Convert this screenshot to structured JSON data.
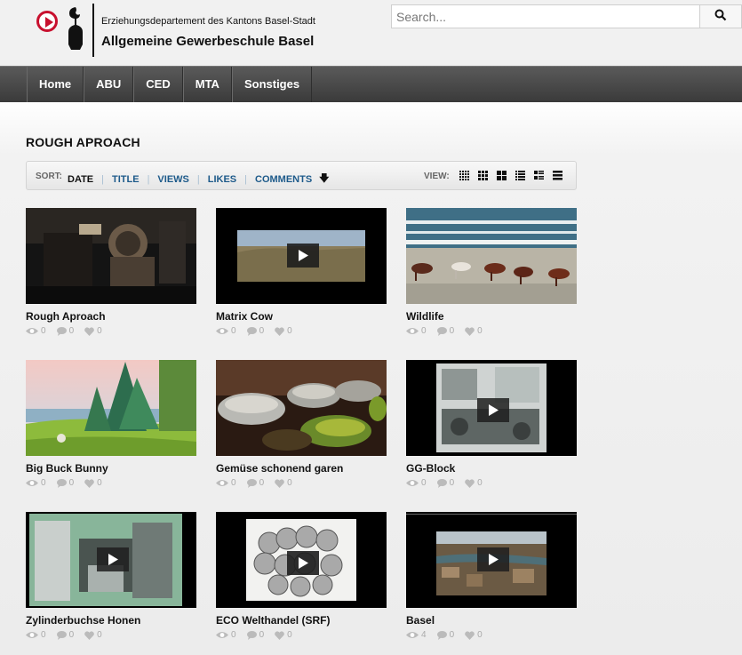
{
  "header": {
    "department": "Erziehungsdepartement des Kantons Basel-Stadt",
    "school": "Allgemeine Gewerbeschule Basel",
    "search_placeholder": "Search..."
  },
  "nav": [
    "Home",
    "ABU",
    "CED",
    "MTA",
    "Sonstiges"
  ],
  "page_title": "ROUGH APROACH",
  "sortbar": {
    "sort_label": "SORT:",
    "options": [
      "DATE",
      "TITLE",
      "VIEWS",
      "LIKES",
      "COMMENTS"
    ],
    "active": "DATE",
    "view_label": "VIEW:"
  },
  "videos": [
    {
      "title": "Rough Aproach",
      "views": "0",
      "comments": "0",
      "likes": "0"
    },
    {
      "title": "Matrix Cow",
      "views": "0",
      "comments": "0",
      "likes": "0"
    },
    {
      "title": "Wildlife",
      "views": "0",
      "comments": "0",
      "likes": "0"
    },
    {
      "title": "Big Buck Bunny",
      "views": "0",
      "comments": "0",
      "likes": "0"
    },
    {
      "title": "Gemüse schonend garen",
      "views": "0",
      "comments": "0",
      "likes": "0"
    },
    {
      "title": "GG-Block",
      "views": "0",
      "comments": "0",
      "likes": "0"
    },
    {
      "title": "Zylinderbuchse Honen",
      "views": "0",
      "comments": "0",
      "likes": "0"
    },
    {
      "title": "ECO Welthandel (SRF)",
      "views": "0",
      "comments": "0",
      "likes": "0"
    },
    {
      "title": "Basel",
      "views": "4",
      "comments": "0",
      "likes": "0"
    }
  ]
}
